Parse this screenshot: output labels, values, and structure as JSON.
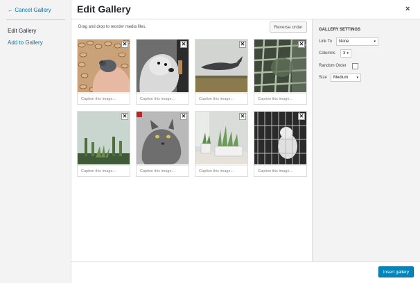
{
  "menu": {
    "cancel_label": "← Cancel Gallery",
    "edit_label": "Edit Gallery",
    "add_label": "Add to Gallery"
  },
  "header": {
    "title": "Edit Gallery",
    "close_glyph": "×"
  },
  "toolbar": {
    "instructions": "Drag and drop to reorder media files.",
    "reverse_label": "Reverse order"
  },
  "gallery": {
    "caption_placeholder": "Caption this image...",
    "remove_glyph": "✕",
    "items": [
      {
        "subject": "peanuts-hand"
      },
      {
        "subject": "dog"
      },
      {
        "subject": "whale-sky"
      },
      {
        "subject": "green-grid"
      },
      {
        "subject": "cactus"
      },
      {
        "subject": "cat"
      },
      {
        "subject": "succulents"
      },
      {
        "subject": "cat-cage"
      }
    ]
  },
  "settings": {
    "heading": "GALLERY SETTINGS",
    "link_to_label": "Link To",
    "link_to_value": "None",
    "columns_label": "Columns",
    "columns_value": "3",
    "random_label": "Random Order",
    "size_label": "Size",
    "size_value": "Medium",
    "caret": "▾"
  },
  "footer": {
    "insert_label": "Insert gallery"
  },
  "colors": {
    "accent": "#0085ba",
    "link": "#0073aa"
  }
}
